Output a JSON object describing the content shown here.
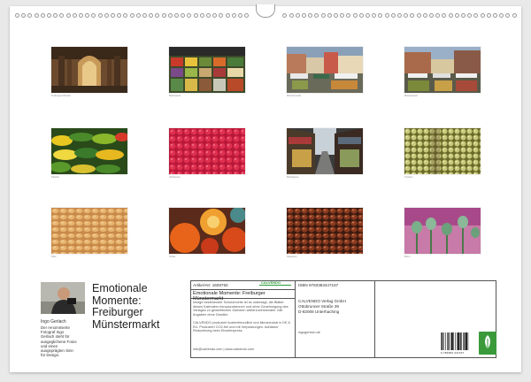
{
  "captions": [
    "Freiburger Münster",
    "Marktstand",
    "Münstermarkt",
    "Münsterplatz",
    "Paprika",
    "Himbeeren",
    "Marktgasse",
    "Trauben",
    "Pilze",
    "Kürbis",
    "Kastanien",
    "Mohn"
  ],
  "title": {
    "line1": "Emotionale",
    "line2": "Momente:",
    "line3": "Freiburger",
    "line4": "Münstermarkt"
  },
  "author": {
    "name": "Ingo Gerlach",
    "bio": "Der renommierte Fotograf Ingo Gerlach steht für ausgeglichene Fotos und einen ausgeprägten Sinn für Design."
  },
  "imprint": {
    "article": "Artikel-Nr: 1609750",
    "logo": "CALVENDO",
    "subtitle_title": "Emotionale Momente: Freiburger Münstermarkt",
    "legal": "Infolge bestehender Schutzrechte ist es untersagt, die Blätter dieses Kalenders herauszutrennen und ohne Genehmigung des Verlages zu gewerblichen Zwecken weiterzuverwenden. Alle Angaben ohne Gewähr.",
    "eco": "CALVENDO produziert kostenfreundlich und klimaneutral in DE & EU. Produziert CO2-frei und mit Verpackungen. Adhäsive Reduzierung beim Einzelexpress.",
    "email": "info@calvendo.com | www.calvendo.com",
    "isbn": "ISBN 9783383447167",
    "publisher_line1": "CALVENDO Verlag GmbH",
    "publisher_line2": "Ottobrunner Straße 39",
    "publisher_line3": "D-82008 Unterhaching",
    "website": "ingogerlach.de",
    "barcode_number": "9 783383 447167"
  }
}
